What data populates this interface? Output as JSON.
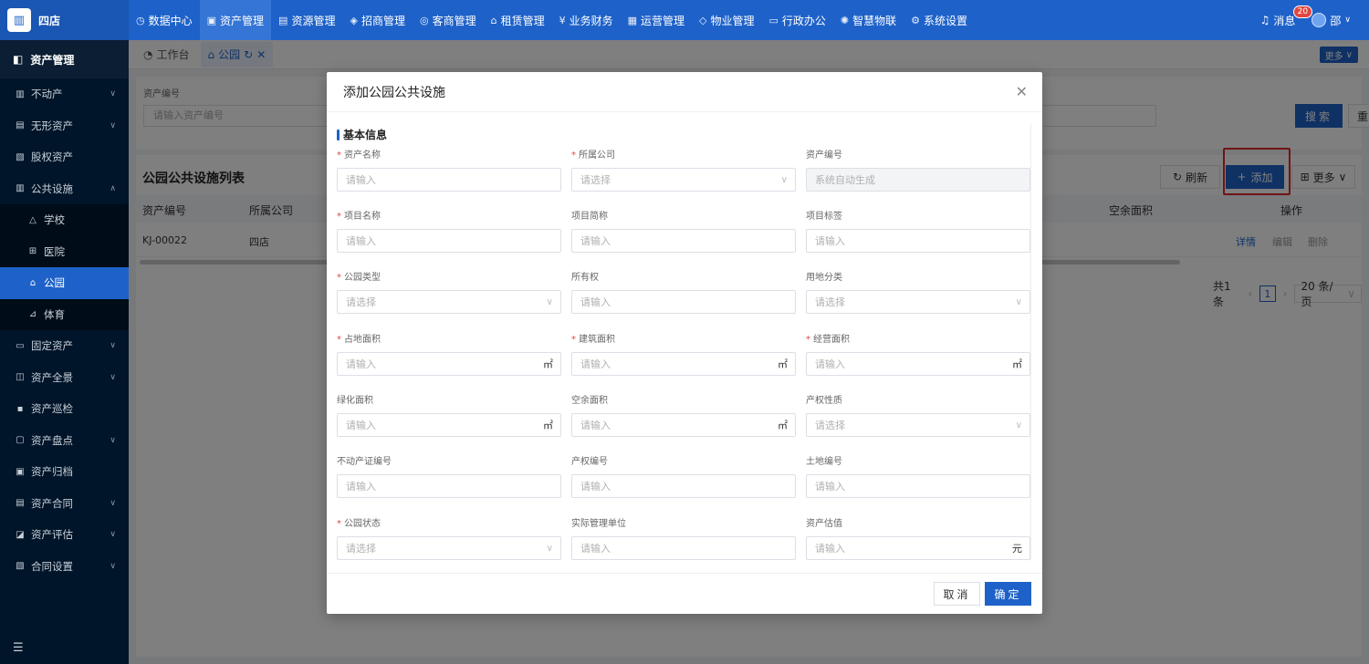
{
  "brand": {
    "name": "四店"
  },
  "nav": [
    {
      "label": "数据中心",
      "icon": "clock-icon"
    },
    {
      "label": "资产管理",
      "icon": "cube-icon"
    },
    {
      "label": "资源管理",
      "icon": "document-icon"
    },
    {
      "label": "招商管理",
      "icon": "tag-icon"
    },
    {
      "label": "客商管理",
      "icon": "users-icon"
    },
    {
      "label": "租赁管理",
      "icon": "home-icon"
    },
    {
      "label": "业务财务",
      "icon": "yuan-icon"
    },
    {
      "label": "运营管理",
      "icon": "chart-icon"
    },
    {
      "label": "物业管理",
      "icon": "building-icon"
    },
    {
      "label": "行政办公",
      "icon": "monitor-icon"
    },
    {
      "label": "智慧物联",
      "icon": "sun-icon"
    },
    {
      "label": "系统设置",
      "icon": "gear-icon"
    }
  ],
  "topright": {
    "messages_label": "消息",
    "messages_count": "20",
    "user_name": "邵"
  },
  "sidebar": {
    "title": "资产管理",
    "items": [
      {
        "label": "不动产"
      },
      {
        "label": "无形资产"
      },
      {
        "label": "股权资产"
      },
      {
        "label": "公共设施"
      },
      {
        "label": "学校"
      },
      {
        "label": "医院"
      },
      {
        "label": "公园"
      },
      {
        "label": "体育"
      },
      {
        "label": "固定资产"
      },
      {
        "label": "资产全景"
      },
      {
        "label": "资产巡检"
      },
      {
        "label": "资产盘点"
      },
      {
        "label": "资产归档"
      },
      {
        "label": "资产合同"
      },
      {
        "label": "资产评估"
      },
      {
        "label": "合同设置"
      }
    ]
  },
  "tabs": [
    {
      "label": "工作台"
    },
    {
      "label": "公园"
    }
  ],
  "tabs_more": "更多",
  "search": {
    "label": "资产编号",
    "placeholder": "请输入资产编号",
    "search_btn": "搜索",
    "reset_btn": "重置"
  },
  "table": {
    "title": "公园公共设施列表",
    "refresh": "刷新",
    "add": "添加",
    "more": "更多",
    "columns": [
      "资产编号",
      "所属公司",
      "空余面积",
      "操作"
    ],
    "row": {
      "code": "KJ-00022",
      "company": "四店",
      "actions": [
        "详情",
        "编辑",
        "删除"
      ]
    },
    "pager": {
      "total": "共1条",
      "page": "1",
      "size": "20 条/页"
    }
  },
  "modal": {
    "title": "添加公园公共设施",
    "section": "基本信息",
    "fields": [
      {
        "label": "资产名称",
        "required": true,
        "value": "请输入"
      },
      {
        "label": "所属公司",
        "required": true,
        "value": "请选择"
      },
      {
        "label": "资产编号",
        "required": false,
        "value": "系统自动生成"
      },
      {
        "label": "项目名称",
        "required": true,
        "value": "请输入"
      },
      {
        "label": "项目简称",
        "required": false,
        "value": "请输入"
      },
      {
        "label": "项目标签",
        "required": false,
        "value": "请输入"
      },
      {
        "label": "公园类型",
        "required": true,
        "value": "请选择"
      },
      {
        "label": "所有权",
        "required": false,
        "value": "请输入"
      },
      {
        "label": "用地分类",
        "required": false,
        "value": "请选择"
      },
      {
        "label": "占地面积",
        "required": true,
        "value": "请输入",
        "unit": "㎡"
      },
      {
        "label": "建筑面积",
        "required": true,
        "value": "请输入",
        "unit": "㎡"
      },
      {
        "label": "经营面积",
        "required": true,
        "value": "请输入",
        "unit": "㎡"
      },
      {
        "label": "绿化面积",
        "required": false,
        "value": "请输入",
        "unit": "㎡"
      },
      {
        "label": "空余面积",
        "required": false,
        "value": "请输入",
        "unit": "㎡"
      },
      {
        "label": "产权性质",
        "required": false,
        "value": "请选择"
      },
      {
        "label": "不动产证编号",
        "required": false,
        "value": "请输入"
      },
      {
        "label": "产权编号",
        "required": false,
        "value": "请输入"
      },
      {
        "label": "土地编号",
        "required": false,
        "value": "请输入"
      },
      {
        "label": "公园状态",
        "required": true,
        "value": "请选择"
      },
      {
        "label": "实际管理单位",
        "required": false,
        "value": "请输入"
      },
      {
        "label": "资产估值",
        "required": false,
        "value": "请输入",
        "unit": "元"
      }
    ],
    "cancel": "取消",
    "ok": "确定"
  }
}
